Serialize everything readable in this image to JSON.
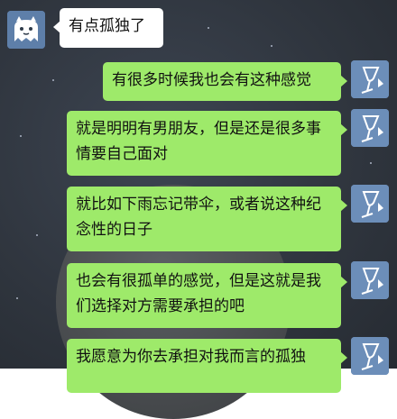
{
  "conversation": {
    "incoming": {
      "avatar_icon": "cat-ghost-avatar-icon",
      "text": "有点孤独了"
    },
    "outgoing": [
      {
        "text": "有很多时候我也会有这种感觉",
        "avatar_icon": "wine-glass-avatar-icon"
      },
      {
        "text": "就是明明有男朋友，但是还是很多事情要自己面对",
        "avatar_icon": "wine-glass-avatar-icon"
      },
      {
        "text": "就比如下雨忘记带伞，或者说这种纪念性的日子",
        "avatar_icon": "wine-glass-avatar-icon"
      },
      {
        "text": "也会有很孤单的感觉，但是这就是我们选择对方需要承担的吧",
        "avatar_icon": "wine-glass-avatar-icon"
      },
      {
        "text": "我愿意为你去承担对我而言的孤独",
        "avatar_icon": "wine-glass-avatar-icon"
      }
    ]
  },
  "colors": {
    "outgoing_bubble": "#9eea6a",
    "incoming_bubble": "#ffffff",
    "background": "#30363f"
  }
}
